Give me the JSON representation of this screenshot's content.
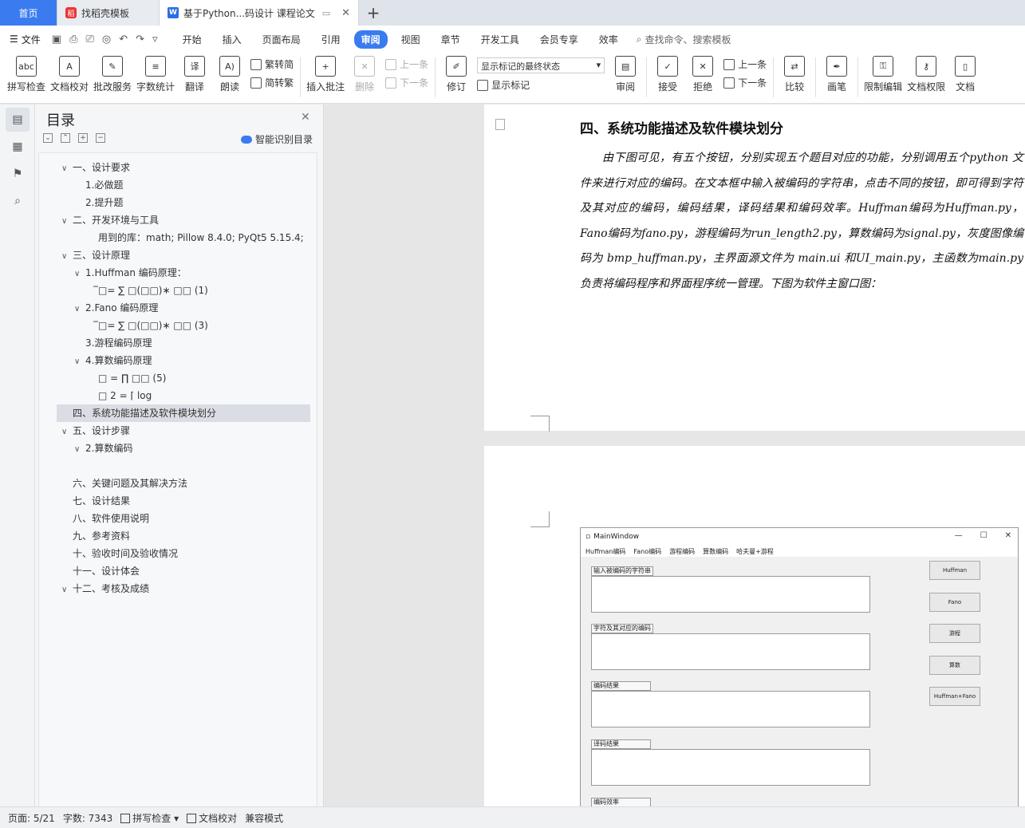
{
  "tabs": {
    "home": "首页",
    "template": "找稻壳模板",
    "doc": "基于Python...码设计 课程论文"
  },
  "menubar": {
    "file": "文件",
    "items": [
      "开始",
      "插入",
      "页面布局",
      "引用",
      "审阅",
      "视图",
      "章节",
      "开发工具",
      "会员专享",
      "效率"
    ],
    "search": "查找命令、搜索模板"
  },
  "ribbon": {
    "spell": "拼写检查",
    "proof": "文档校对",
    "review_service": "批改服务",
    "wordcount": "字数统计",
    "translate": "翻译",
    "read": "朗读",
    "trad": "繁转简",
    "simp": "简转繁",
    "insert_comment": "插入批注",
    "delete": "删除",
    "prev": "上一条",
    "next": "下一条",
    "revise": "修订",
    "markup_state": "显示标记的最终状态",
    "show_markup": "显示标记",
    "review": "审阅",
    "accept": "接受",
    "reject": "拒绝",
    "prev2": "上一条",
    "next2": "下一条",
    "compare": "比较",
    "pen": "画笔",
    "restrict": "限制编辑",
    "doc_perm": "文档权限",
    "doc_more": "文档"
  },
  "toc": {
    "title": "目录",
    "smart": "智能识别目录",
    "items": [
      "一、设计要求",
      "1.必做题",
      "2.提升题",
      "二、开发环境与工具",
      "用到的库：math; Pillow 8.4.0; PyQt5 5.15.4;",
      "三、设计原理",
      "1.Huffman 编码原理：",
      "̅□= ∑ □(□□)∗  □□  (1)",
      "2.Fano 编码原理",
      "̅□= ∑ □(□□)∗  □□  (3)",
      "3.游程编码原理",
      "4.算数编码原理",
      "□ = ∏ □□   (5)",
      "□        2 = ⌈ log",
      "四、系统功能描述及软件模块划分",
      "五、设计步骤",
      "2.算数编码",
      "六、关键问题及其解决方法",
      "七、设计结果",
      "八、软件使用说明",
      "九、参考资料",
      "十、验收时间及验收情况",
      "十一、设计体会",
      "十二、考核及成绩"
    ]
  },
  "doc": {
    "heading": "四、系统功能描述及软件模块划分",
    "paragraph": "由下图可见，有五个按钮，分别实现五个题目对应的功能，分别调用五个python 文件来进行对应的编码。在文本框中输入被编码的字符串，点击不同的按钮，即可得到字符及其对应的编码，编码结果，译码结果和编码效率。Huffman编码为Huffman.py，Fano编码为fano.py，游程编码为run_length2.py，算数编码为signal.py，灰度图像编码为 bmp_huffman.py，主界面源文件为 main.ui 和UI_main.py，主函数为main.py 负责将编码程序和界面程序统一管理。下图为软件主窗口图："
  },
  "screenshot": {
    "window_title": "MainWindow",
    "menu": [
      "Huffman编码",
      "Fano编码",
      "游程编码",
      "算数编码",
      "哈夫曼+游程"
    ],
    "groups": [
      "输入被编码的字符串",
      "字符及其对应的编码",
      "编码结果",
      "译码结果",
      "编码效率"
    ],
    "buttons": [
      "Huffman",
      "Fano",
      "游程",
      "算数",
      "Huffman+Fano"
    ]
  },
  "status": {
    "page": "页面: 5/21",
    "words": "字数: 7343",
    "spell": "拼写检查",
    "proof": "文档校对",
    "compat": "兼容模式"
  }
}
